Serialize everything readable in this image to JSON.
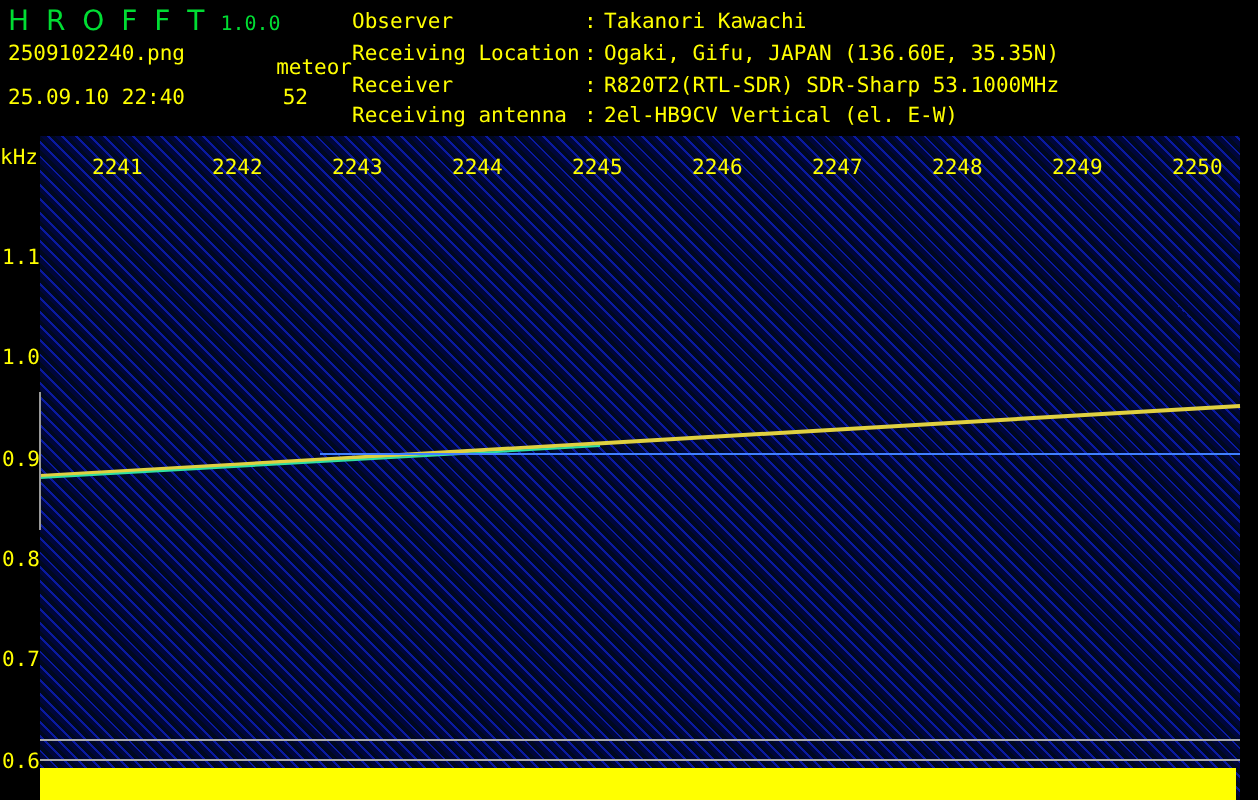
{
  "app": {
    "name": "H R O F F T",
    "version": "1.0.0"
  },
  "file": {
    "name": "2509102240.png",
    "datetime": "25.09.10 22:40"
  },
  "counter": {
    "label": "meteor",
    "value": "52"
  },
  "station": [
    {
      "label": "Observer",
      "separator": ":",
      "value": "Takanori Kawachi"
    },
    {
      "label": "Receiving Location",
      "separator": ":",
      "value": "Ogaki, Gifu, JAPAN (136.60E, 35.35N)"
    },
    {
      "label": "Receiver",
      "separator": ":",
      "value": "R820T2(RTL-SDR) SDR-Sharp 53.1000MHz"
    },
    {
      "label": "Receiving antenna",
      "separator": ":",
      "value": "2el-HB9CV Vertical (el. E-W)"
    }
  ],
  "spectrogram": {
    "unit": "kHz",
    "x_labels": [
      "2241",
      "2242",
      "2243",
      "2244",
      "2245",
      "2246",
      "2247",
      "2248",
      "2249",
      "2250"
    ],
    "y_labels": [
      "1.1",
      "1.0",
      "0.9",
      "0.8",
      "0.7",
      "0.6"
    ]
  }
}
